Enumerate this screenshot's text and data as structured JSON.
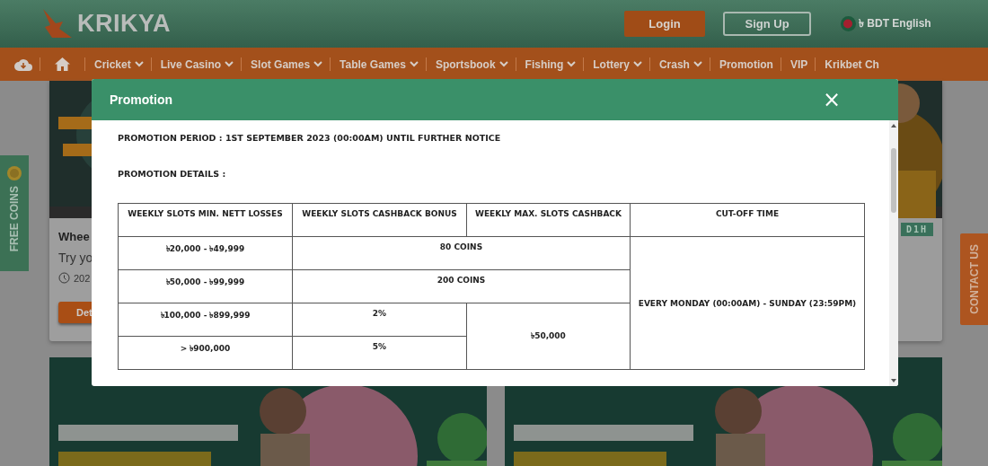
{
  "header": {
    "logo": "KRIKYA",
    "login": "Login",
    "signup": "Sign Up",
    "language": "৳ BDT English"
  },
  "nav": [
    {
      "label": "Cricket",
      "dropdown": true
    },
    {
      "label": "Live Casino",
      "dropdown": true
    },
    {
      "label": "Slot Games",
      "dropdown": true
    },
    {
      "label": "Table Games",
      "dropdown": true
    },
    {
      "label": "Sportsbook",
      "dropdown": true
    },
    {
      "label": "Fishing",
      "dropdown": true
    },
    {
      "label": "Lottery",
      "dropdown": true
    },
    {
      "label": "Crash",
      "dropdown": true
    },
    {
      "label": "Promotion",
      "dropdown": false
    },
    {
      "label": "VIP",
      "dropdown": false
    },
    {
      "label": "Krikbet Ch",
      "dropdown": false
    }
  ],
  "side_tabs": {
    "left": "FREE COINS",
    "right": "CONTACT US"
  },
  "cards": {
    "left": {
      "title": "Whee",
      "text": "Try yo",
      "date": "202",
      "button": "Det"
    },
    "right": {
      "code": "D1H"
    }
  },
  "modal": {
    "title": "Promotion",
    "close": "×",
    "period": "PROMOTION PERIOD : 1ST SEPTEMBER 2023 (00:00AM) UNTIL FURTHER NOTICE",
    "details": "PROMOTION DETAILS :",
    "table": {
      "columns": [
        "WEEKLY SLOTS MIN. NETT LOSSES",
        "WEEKLY SLOTS CASHBACK BONUS",
        "WEEKLY MAX. SLOTS CASHBACK",
        "CUT-OFF TIME"
      ],
      "rows": [
        {
          "losses": "৳20,000 - ৳49,999",
          "bonus": "80 COINS",
          "bonus_wide": true
        },
        {
          "losses": "৳50,000 - ৳99,999",
          "bonus": "200 COINS",
          "bonus_wide": true
        },
        {
          "losses": "৳100,000 - ৳899,999",
          "bonus": "2%",
          "bonus_wide": false
        },
        {
          "losses": "> ৳900,000",
          "bonus": "5%",
          "bonus_wide": false
        }
      ],
      "max_cashback": "৳50,000",
      "cutoff_time": "EVERY MONDAY (00:00AM) - SUNDAY (23:59PM)"
    }
  }
}
